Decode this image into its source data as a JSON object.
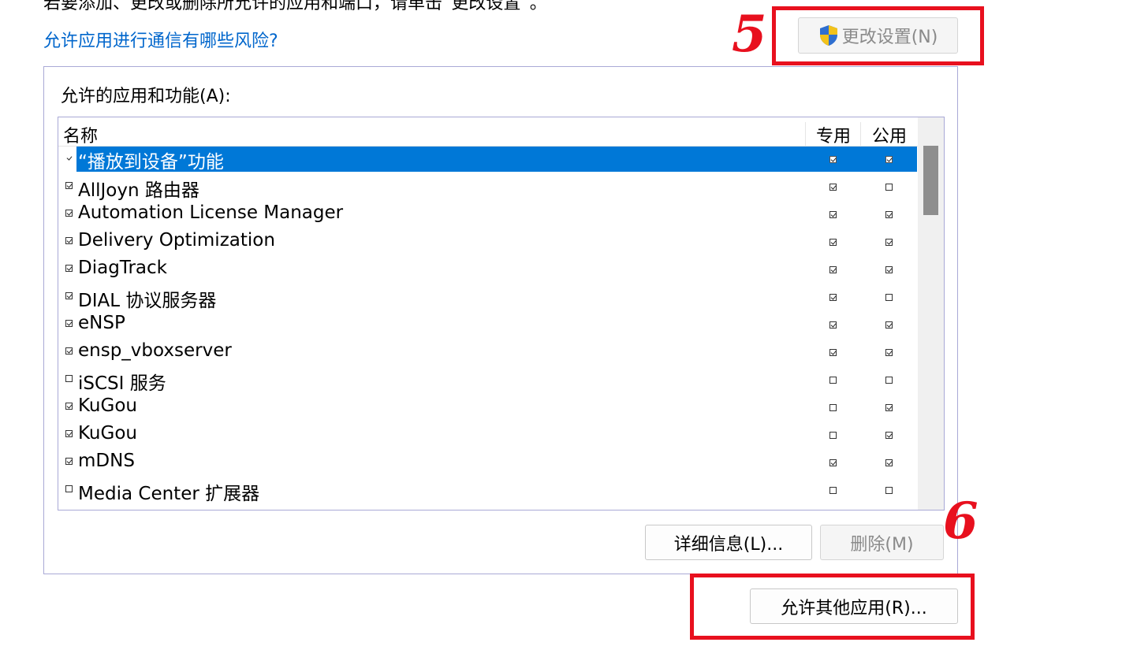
{
  "header": {
    "note": "若要添加、更改或删除所允许的应用和端口，请单击“更改设置”。",
    "risk_link": "允许应用进行通信有哪些风险?",
    "change_settings_label": "更改设置(N)"
  },
  "annotations": {
    "five": "5",
    "six": "6",
    "color": "#e8101e"
  },
  "group": {
    "label": "允许的应用和功能(A):",
    "columns": {
      "name": "名称",
      "private": "专用",
      "public": "公用"
    },
    "rows": [
      {
        "name": "“播放到设备”功能",
        "enabled": true,
        "private": true,
        "public": true,
        "selected": true
      },
      {
        "name": "AllJoyn 路由器",
        "enabled": true,
        "private": true,
        "public": false
      },
      {
        "name": "Automation License Manager",
        "enabled": true,
        "private": true,
        "public": true
      },
      {
        "name": "Delivery Optimization",
        "enabled": true,
        "private": true,
        "public": true
      },
      {
        "name": "DiagTrack",
        "enabled": true,
        "private": true,
        "public": true
      },
      {
        "name": "DIAL 协议服务器",
        "enabled": true,
        "private": true,
        "public": false
      },
      {
        "name": "eNSP",
        "enabled": true,
        "private": true,
        "public": true
      },
      {
        "name": "ensp_vboxserver",
        "enabled": true,
        "private": true,
        "public": true
      },
      {
        "name": "iSCSI 服务",
        "enabled": false,
        "private": false,
        "public": false
      },
      {
        "name": "KuGou",
        "enabled": true,
        "private": false,
        "public": true
      },
      {
        "name": "KuGou",
        "enabled": true,
        "private": false,
        "public": true
      },
      {
        "name": "mDNS",
        "enabled": true,
        "private": true,
        "public": true
      },
      {
        "name": "Media Center 扩展器",
        "enabled": false,
        "private": false,
        "public": false
      }
    ]
  },
  "buttons": {
    "details": "详细信息(L)...",
    "delete": "删除(M)",
    "allow_other": "允许其他应用(R)..."
  },
  "colors": {
    "accent": "#0078d7",
    "link": "#0066cc"
  }
}
